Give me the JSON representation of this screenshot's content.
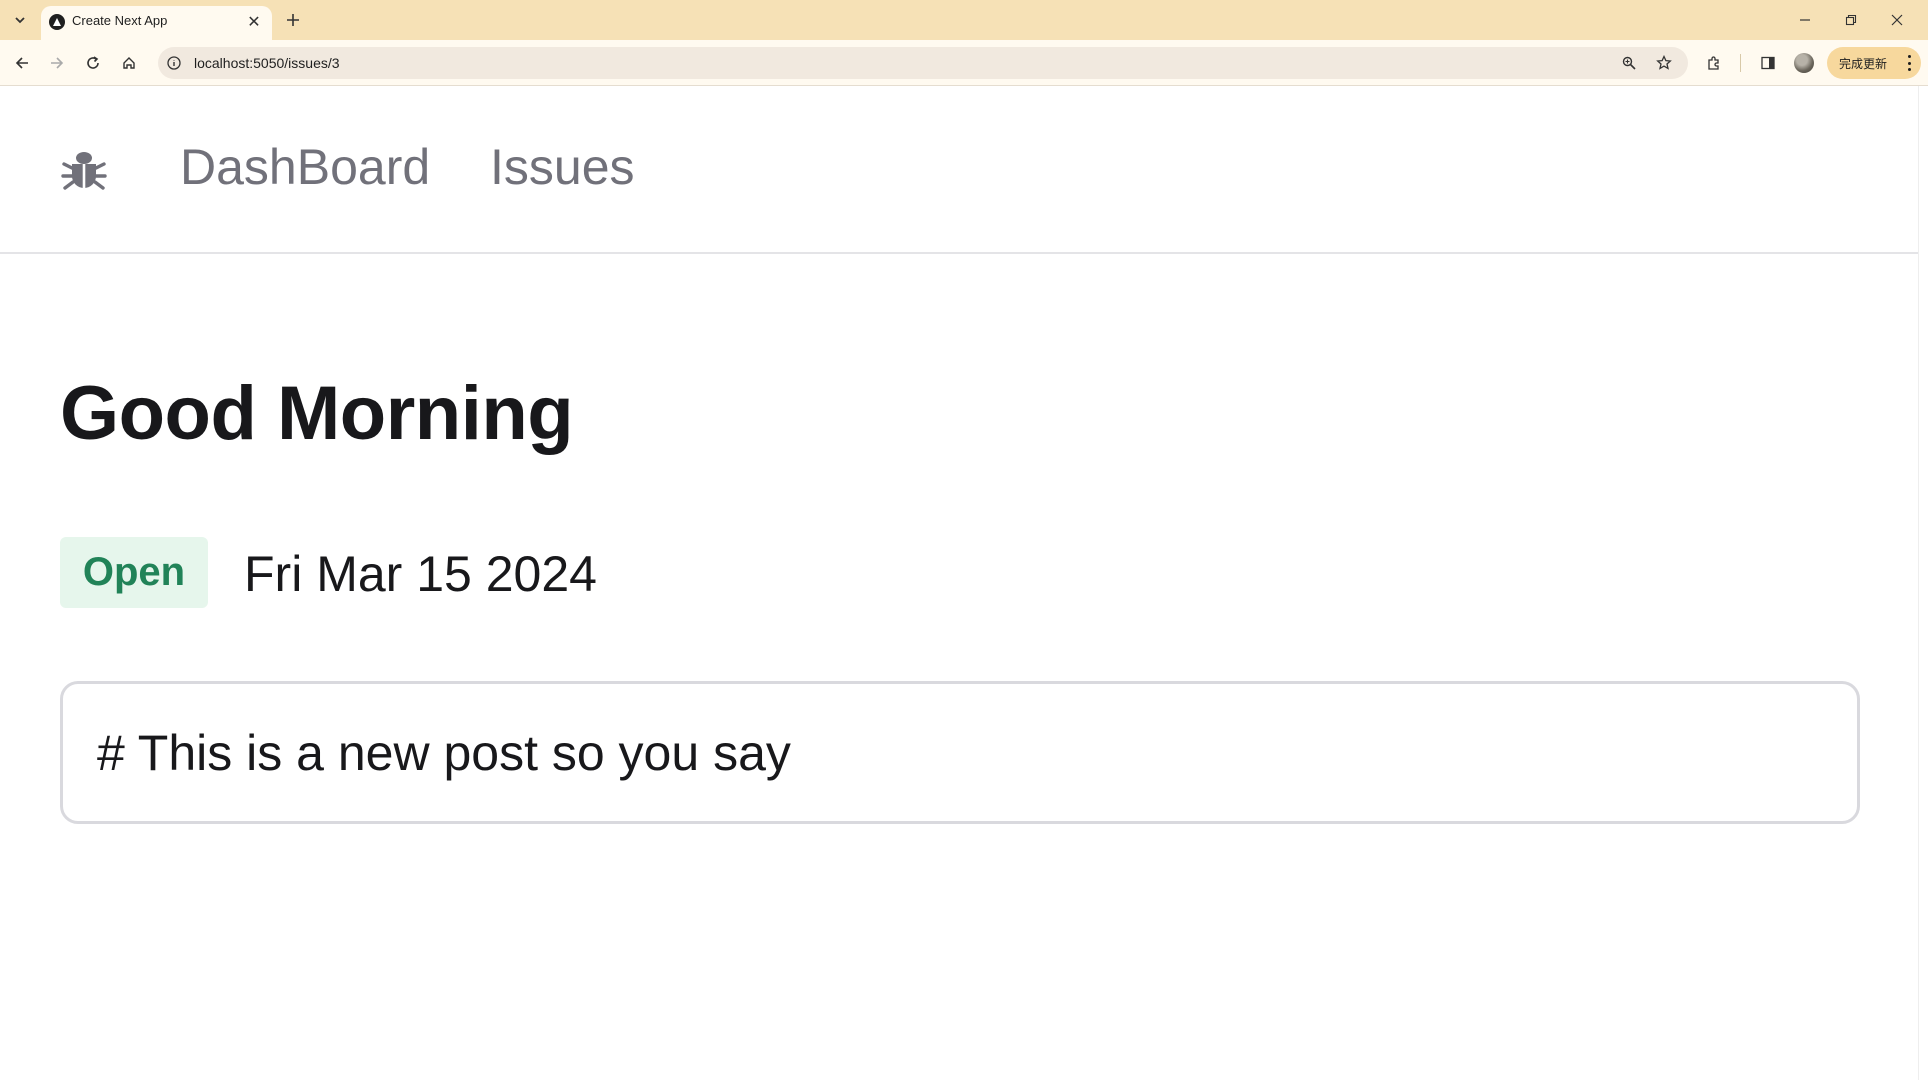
{
  "browser": {
    "tab_title": "Create Next App",
    "tab_close": "✕",
    "url": "localhost:5050/issues/3",
    "update_button": "完成更新"
  },
  "nav": {
    "logo_icon": "bug-icon",
    "links": [
      "DashBoard",
      "Issues"
    ]
  },
  "issue": {
    "title": "Good Morning",
    "status": "Open",
    "date": "Fri Mar 15 2024",
    "description": "# This is a new post so you say"
  },
  "colors": {
    "tabbar_bg": "#f6e1b6",
    "status_bg": "#e6f6ec",
    "status_text": "#218358",
    "nav_text": "#71717a",
    "heading_text": "#18181b"
  }
}
